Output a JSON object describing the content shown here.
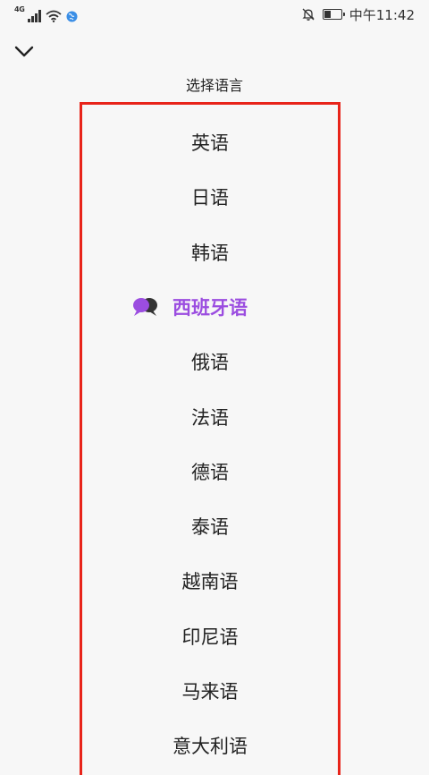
{
  "status_bar": {
    "network_type": "4G",
    "time": "中午11:42",
    "battery_level": 0.45
  },
  "header": {
    "title": "选择语言"
  },
  "languages": [
    {
      "label": "英语"
    },
    {
      "label": "日语"
    },
    {
      "label": "韩语"
    },
    {
      "label": "西班牙语",
      "selected": true
    },
    {
      "label": "俄语"
    },
    {
      "label": "法语"
    },
    {
      "label": "德语"
    },
    {
      "label": "泰语"
    },
    {
      "label": "越南语"
    },
    {
      "label": "印尼语"
    },
    {
      "label": "马来语"
    },
    {
      "label": "意大利语"
    }
  ],
  "colors": {
    "selected_text": "#9b4de0",
    "highlight_border": "#e8241a",
    "background": "#f7f7f7"
  }
}
